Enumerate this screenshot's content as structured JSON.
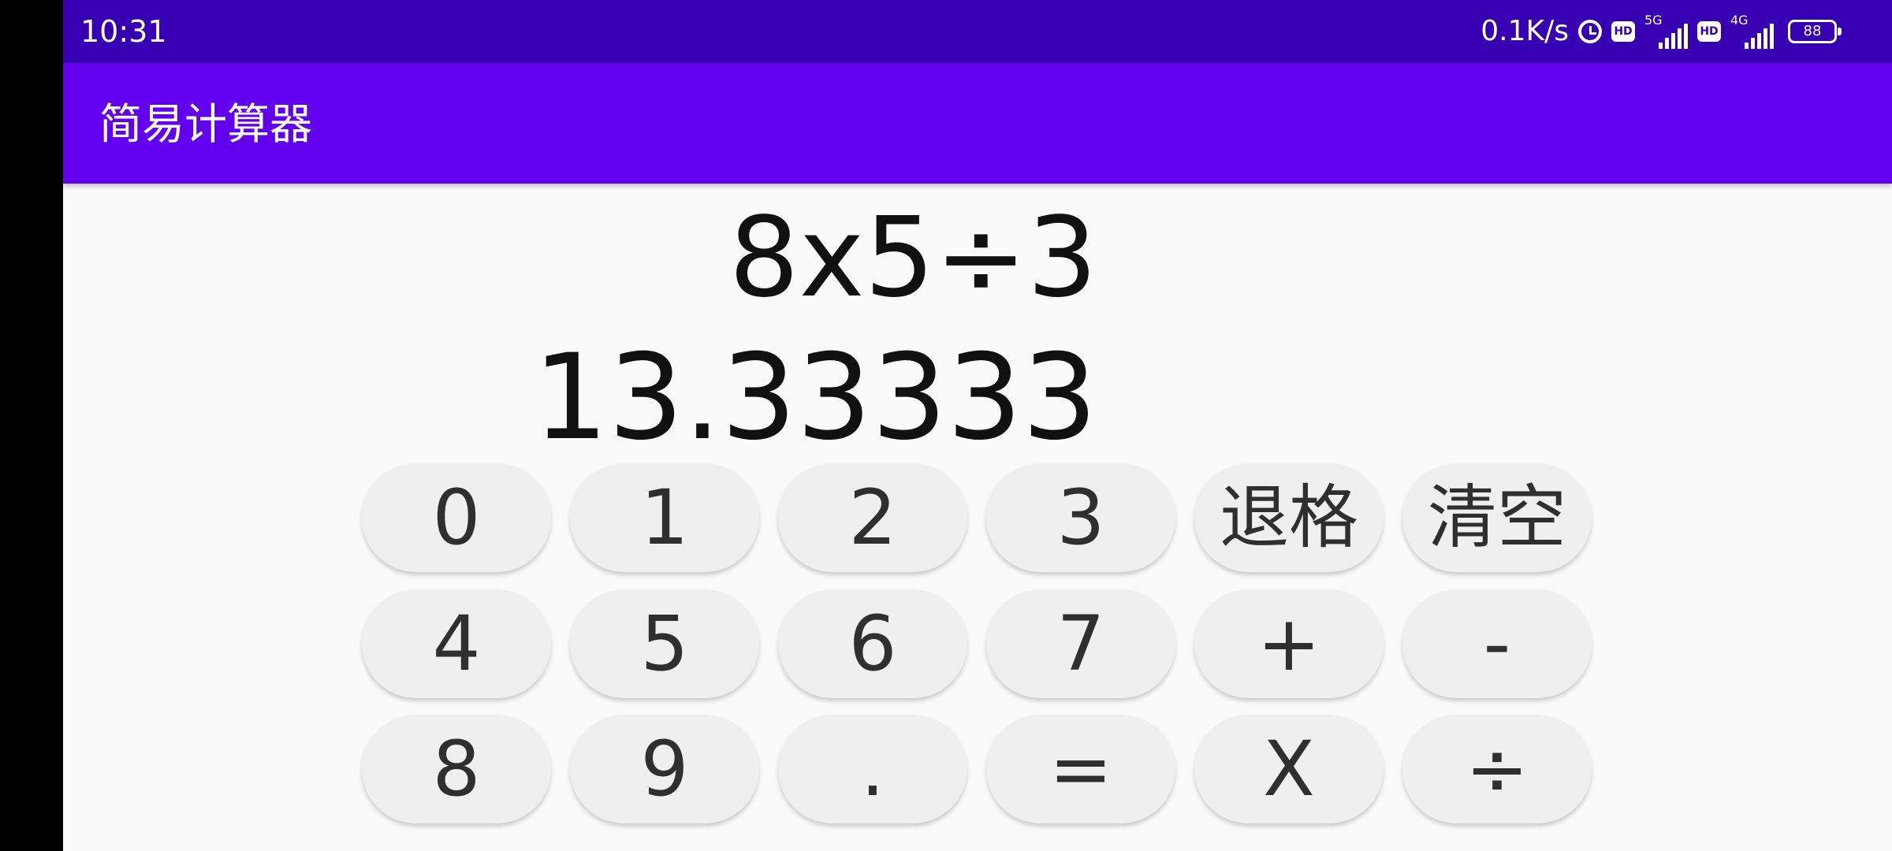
{
  "status_bar": {
    "time": "10:31",
    "net_speed": "0.1K/s",
    "hd1": "HD",
    "net1": "5G",
    "hd2": "HD",
    "net2": "4G",
    "battery": "88"
  },
  "app_bar": {
    "title": "简易计算器"
  },
  "display": {
    "expression": "8x5÷3",
    "result": "13.33333"
  },
  "keys": {
    "k0": "0",
    "k1": "1",
    "k2": "2",
    "k3": "3",
    "backspace": "退格",
    "clear": "清空",
    "k4": "4",
    "k5": "5",
    "k6": "6",
    "k7": "7",
    "plus": "+",
    "minus": "-",
    "k8": "8",
    "k9": "9",
    "dot": ".",
    "equals": "=",
    "multiply": "X",
    "divide": "÷"
  },
  "colors": {
    "status_bar": "#3700b3",
    "app_bar": "#6200ee",
    "background": "#fafafa",
    "key": "#efefef"
  },
  "icons": [
    "alarm-icon",
    "signal-icon",
    "battery-icon"
  ]
}
